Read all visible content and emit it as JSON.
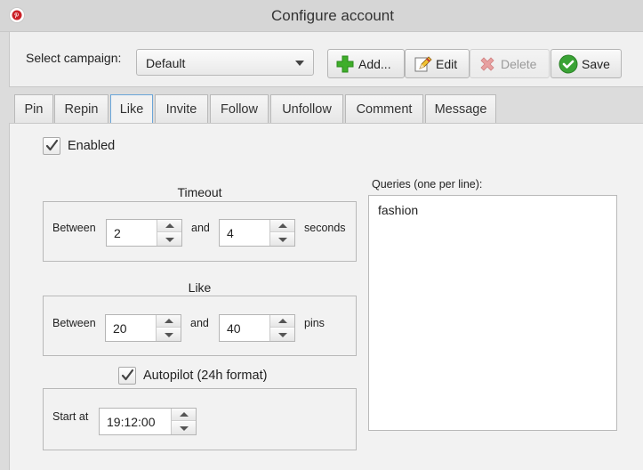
{
  "window": {
    "title": "Configure account",
    "icon": "pinterest-icon"
  },
  "toolbar": {
    "campaign_label": "Select campaign:",
    "campaign_value": "Default",
    "add_label": "Add...",
    "edit_label": "Edit",
    "delete_label": "Delete",
    "save_label": "Save",
    "delete_enabled": false
  },
  "tabs": [
    {
      "label": "Pin"
    },
    {
      "label": "Repin"
    },
    {
      "label": "Like",
      "active": true
    },
    {
      "label": "Invite"
    },
    {
      "label": "Follow"
    },
    {
      "label": "Unfollow"
    },
    {
      "label": "Comment"
    },
    {
      "label": "Message"
    }
  ],
  "like_tab": {
    "enabled_label": "Enabled",
    "enabled_checked": true,
    "timeout": {
      "title": "Timeout",
      "between_label": "Between",
      "from": "2",
      "and_label": "and",
      "to": "4",
      "unit_label": "seconds"
    },
    "like": {
      "title": "Like",
      "between_label": "Between",
      "from": "20",
      "and_label": "and",
      "to": "40",
      "unit_label": "pins"
    },
    "autopilot": {
      "label": "Autopilot (24h format)",
      "checked": true,
      "start_label": "Start at",
      "start_value": "19:12:00"
    },
    "queries": {
      "label": "Queries (one per line):",
      "text": "fashion"
    }
  },
  "colors": {
    "accent_tab_border": "#6aa5d8",
    "add_icon": "#3fae2a",
    "delete_icon": "#e08a8a",
    "save_icon": "#3aa335",
    "pinterest_red": "#cb2027"
  }
}
